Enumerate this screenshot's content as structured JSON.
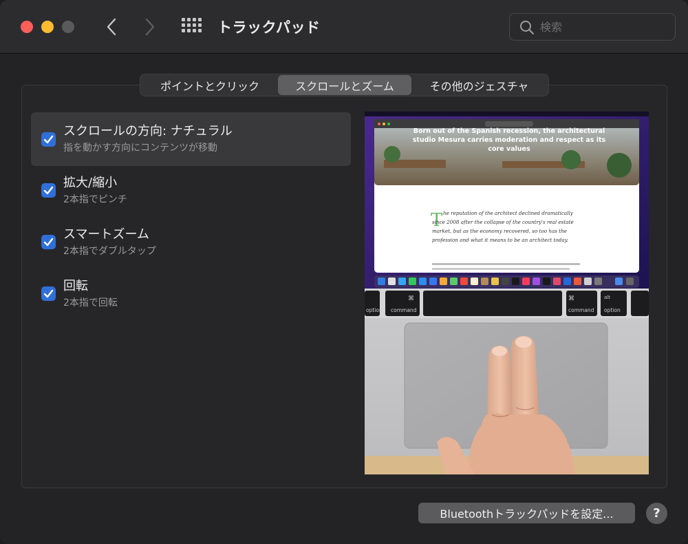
{
  "window": {
    "title": "トラックパッド"
  },
  "search": {
    "placeholder": "検索",
    "value": ""
  },
  "tabs": [
    {
      "label": "ポイントとクリック",
      "selected": false
    },
    {
      "label": "スクロールとズーム",
      "selected": true
    },
    {
      "label": "その他のジェスチャ",
      "selected": false
    }
  ],
  "options": [
    {
      "title": "スクロールの方向: ナチュラル",
      "subtitle": "指を動かす方向にコンテンツが移動",
      "checked": true,
      "selected": true
    },
    {
      "title": "拡大/縮小",
      "subtitle": "2本指でピンチ",
      "checked": true,
      "selected": false
    },
    {
      "title": "スマートズーム",
      "subtitle": "2本指でダブルタップ",
      "checked": true,
      "selected": false
    },
    {
      "title": "回転",
      "subtitle": "2本指で回転",
      "checked": true,
      "selected": false
    }
  ],
  "preview": {
    "headline": "Born out of the Spanish recession, the architectural studio Mesura carries moderation and respect as its core values",
    "article_first_letter": "T",
    "article_text": "he reputation of the architect declined dramatically since 2008 after the collapse of the country's real estate market, but as the economy recovered, so too has the profession and what it means to be an architect today.",
    "key_labels": {
      "option": "option",
      "command": "command",
      "cmd_symbol": "⌘",
      "alt": "alt"
    }
  },
  "footer": {
    "bluetooth_button": "Bluetoothトラックパッドを設定...",
    "help_button": "?"
  },
  "colors": {
    "accent": "#2f6fd9",
    "close": "#ff5f57",
    "minimize": "#febc2e",
    "zoom_disabled": "#5a5a5c"
  }
}
